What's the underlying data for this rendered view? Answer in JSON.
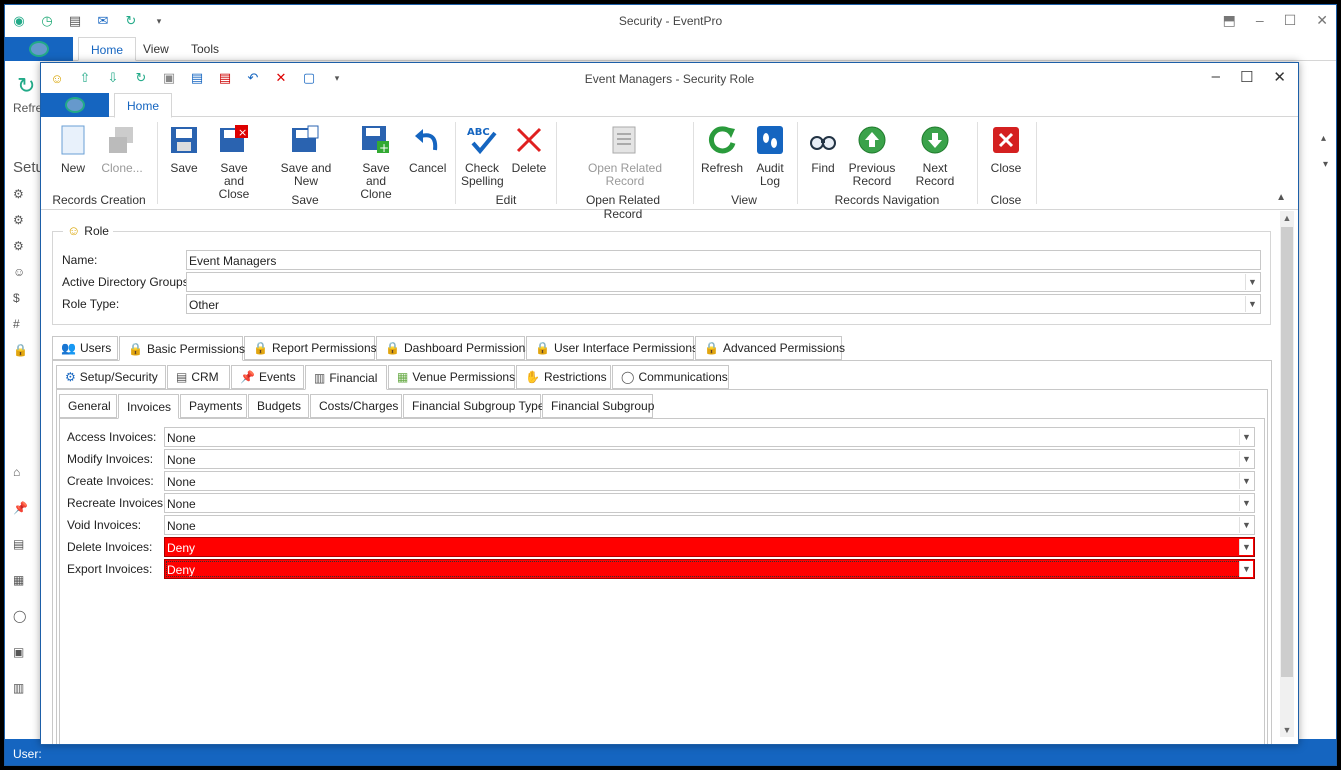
{
  "app": {
    "title": "Security - EventPro",
    "tabs": [
      "Home",
      "View",
      "Tools"
    ],
    "side_label_refresh": "Refre",
    "side_label_setup": "Setu",
    "status_text": "User:"
  },
  "dialog": {
    "title": "Event Managers - Security Role",
    "tab": "Home"
  },
  "ribbon": {
    "new": "New",
    "clone": "Clone...",
    "records_creation": "Records Creation",
    "save": "Save",
    "save_and_close_1": "Save and",
    "save_and_close_2": "Close",
    "save_and_new": "Save and New",
    "save_and_clone_1": "Save and",
    "save_and_clone_2": "Clone",
    "cancel": "Cancel",
    "save_group": "Save",
    "check_spelling_1": "Check",
    "check_spelling_2": "Spelling",
    "check_spelling_icon_text": "ABC",
    "delete": "Delete",
    "edit_group": "Edit",
    "open_related_record_1": "Open Related",
    "open_related_record_2": "Record",
    "open_related_group": "Open Related Record",
    "refresh": "Refresh",
    "audit_log_1": "Audit",
    "audit_log_2": "Log",
    "view_group": "View",
    "find": "Find",
    "previous_record_1": "Previous",
    "previous_record_2": "Record",
    "next_record": "Next Record",
    "records_navigation_group": "Records Navigation",
    "close": "Close",
    "close_group": "Close"
  },
  "role": {
    "legend": "Role",
    "name_label": "Name:",
    "name_value": "Event Managers",
    "ad_groups_label": "Active Directory Groups:",
    "ad_groups_value": "",
    "role_type_label": "Role Type:",
    "role_type_value": "Other"
  },
  "tabs_level1": [
    "Users",
    "Basic Permissions",
    "Report Permissions",
    "Dashboard Permissions",
    "User Interface Permissions",
    "Advanced Permissions"
  ],
  "tabs_level2": [
    "Setup/Security",
    "CRM",
    "Events",
    "Financial",
    "Venue Permissions",
    "Restrictions",
    "Communications"
  ],
  "tabs_level3": [
    "General",
    "Invoices",
    "Payments",
    "Budgets",
    "Costs/Charges",
    "Financial Subgroup Type",
    "Financial Subgroup"
  ],
  "permissions": [
    {
      "label": "Access Invoices:",
      "value": "None"
    },
    {
      "label": "Modify Invoices:",
      "value": "None"
    },
    {
      "label": "Create Invoices:",
      "value": "None"
    },
    {
      "label": "Recreate Invoices:",
      "value": "None"
    },
    {
      "label": "Void Invoices:",
      "value": "None"
    },
    {
      "label": "Delete Invoices:",
      "value": "Deny"
    },
    {
      "label": "Export Invoices:",
      "value": "Deny"
    }
  ],
  "colors": {
    "accent": "#1565c0",
    "deny": "#ff0000"
  }
}
